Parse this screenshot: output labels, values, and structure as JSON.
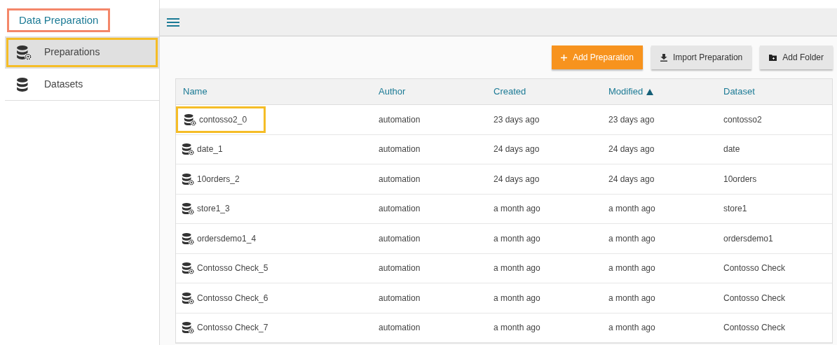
{
  "app_title": {
    "text": "Data Preparation",
    "highlighted": true
  },
  "sidebar": {
    "items": [
      {
        "label": "Preparations",
        "selected": true,
        "highlighted": true
      },
      {
        "label": "Datasets",
        "selected": false,
        "highlighted": false
      }
    ]
  },
  "toolbar": {
    "buttons": [
      {
        "label": "Add Preparation",
        "kind": "primary"
      },
      {
        "label": "Import Preparation",
        "kind": "secondary"
      },
      {
        "label": "Add Folder",
        "kind": "secondary"
      }
    ]
  },
  "table": {
    "columns": [
      {
        "label": "Name",
        "sorted": false
      },
      {
        "label": "Author",
        "sorted": false
      },
      {
        "label": "Created",
        "sorted": false
      },
      {
        "label": "Modified",
        "sorted": true
      },
      {
        "label": "Dataset",
        "sorted": false
      }
    ],
    "rows": [
      {
        "name": "contosso2_0",
        "highlighted": true,
        "author": "automation",
        "created": "23 days ago",
        "modified": "23 days ago",
        "dataset": "contosso2"
      },
      {
        "name": "date_1",
        "highlighted": false,
        "author": "automation",
        "created": "24 days ago",
        "modified": "24 days ago",
        "dataset": "date"
      },
      {
        "name": "10orders_2",
        "highlighted": false,
        "author": "automation",
        "created": "24 days ago",
        "modified": "24 days ago",
        "dataset": "10orders"
      },
      {
        "name": "store1_3",
        "highlighted": false,
        "author": "automation",
        "created": "a month ago",
        "modified": "a month ago",
        "dataset": "store1"
      },
      {
        "name": "ordersdemo1_4",
        "highlighted": false,
        "author": "automation",
        "created": "a month ago",
        "modified": "a month ago",
        "dataset": "ordersdemo1"
      },
      {
        "name": "Contosso Check_5",
        "highlighted": false,
        "author": "automation",
        "created": "a month ago",
        "modified": "a month ago",
        "dataset": "Contosso Check"
      },
      {
        "name": "Contosso Check_6",
        "highlighted": false,
        "author": "automation",
        "created": "a month ago",
        "modified": "a month ago",
        "dataset": "Contosso Check"
      },
      {
        "name": "Contosso Check_7",
        "highlighted": false,
        "author": "automation",
        "created": "a month ago",
        "modified": "a month ago",
        "dataset": "Contosso Check"
      }
    ]
  }
}
